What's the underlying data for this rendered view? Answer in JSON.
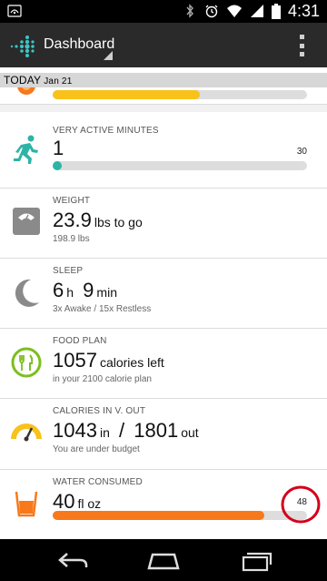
{
  "status_bar": {
    "time": "4:31",
    "icons": [
      "notification-icon",
      "bluetooth-icon",
      "alarm-icon",
      "wifi-icon",
      "signal-icon",
      "battery-icon"
    ]
  },
  "app_bar": {
    "title": "Dashboard",
    "logo": "fitbit-logo-icon",
    "menu_icon": "overflow-menu-icon"
  },
  "today": {
    "label": "TODAY",
    "date": "Jan 21"
  },
  "cards": {
    "partial_top": {
      "progress_fraction": 0.58,
      "color": "#f8c21b"
    },
    "active_minutes": {
      "label": "VERY ACTIVE MINUTES",
      "value": "1",
      "goal": "30",
      "progress_fraction": 0.033,
      "color": "#2cb5a5"
    },
    "weight": {
      "label": "WEIGHT",
      "value": "23.9",
      "unit": "lbs to go",
      "sub": "198.9 lbs"
    },
    "sleep": {
      "label": "SLEEP",
      "hours": "6",
      "h_unit": "h",
      "minutes": "9",
      "m_unit": "min",
      "sub": "3x Awake / 15x Restless"
    },
    "food_plan": {
      "label": "FOOD PLAN",
      "value": "1057",
      "unit": "calories left",
      "sub": "in your 2100 calorie plan"
    },
    "calories": {
      "label": "CALORIES IN V. OUT",
      "in_value": "1043",
      "in_unit": "in",
      "separator": "/",
      "out_value": "1801",
      "out_unit": "out",
      "sub": "You are under budget"
    },
    "water": {
      "label": "WATER CONSUMED",
      "value": "40",
      "unit": "fl oz",
      "goal": "48",
      "progress_fraction": 0.83,
      "color": "#f7791b"
    }
  },
  "colors": {
    "teal": "#2cb5a5",
    "grey_icon": "#8a8a8a",
    "food_green": "#7cbe1f",
    "gauge_yellow": "#f8c21b",
    "water_orange": "#f7791b",
    "highlight_red": "#d4001a"
  },
  "nav_bar": {
    "icons": [
      "back-icon",
      "home-icon",
      "recent-apps-icon"
    ]
  }
}
